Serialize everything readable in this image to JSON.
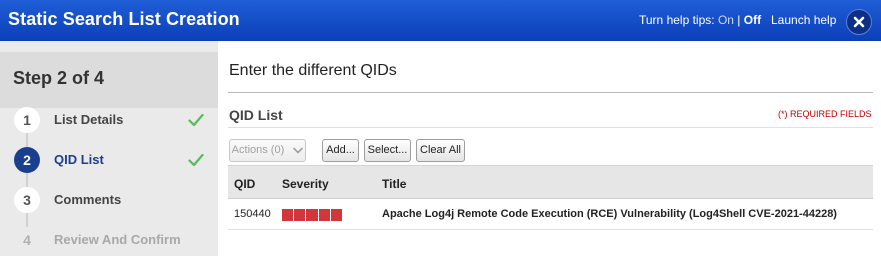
{
  "header": {
    "title": "Static Search List Creation",
    "help_prefix": "Turn help tips:",
    "help_on": "On",
    "help_sep": "|",
    "help_off": "Off",
    "launch_help": "Launch help",
    "colors": {
      "bar": "#1a53c8",
      "close_bg": "#0d2f86"
    }
  },
  "sidebar": {
    "step_title": "Step 2 of 4",
    "steps": [
      {
        "number": "1",
        "label": "List Details",
        "state": "complete"
      },
      {
        "number": "2",
        "label": "QID List",
        "state": "current"
      },
      {
        "number": "3",
        "label": "Comments",
        "state": "pending"
      },
      {
        "number": "4",
        "label": "Review And Confirm",
        "state": "disabled"
      }
    ],
    "check_icon": "checkmark-icon",
    "colors": {
      "active": "#1b3f8f",
      "check": "#5cb85c"
    }
  },
  "main": {
    "title": "Enter the different QIDs",
    "section_title": "QID List",
    "required_note": "(*) REQUIRED FIELDS",
    "buttons": {
      "actions": "Actions (0)",
      "add": "Add...",
      "select": "Select...",
      "clear_all": "Clear All"
    },
    "table": {
      "columns": [
        "QID",
        "Severity",
        "Title"
      ],
      "rows": [
        {
          "qid": "150440",
          "severity": 5,
          "severity_max": 5,
          "title": "Apache Log4j Remote Code Execution (RCE) Vulnerability (Log4Shell CVE-2021-44228)"
        }
      ]
    },
    "colors": {
      "severity_fill": "#d2363a",
      "required": "#c00000"
    }
  }
}
